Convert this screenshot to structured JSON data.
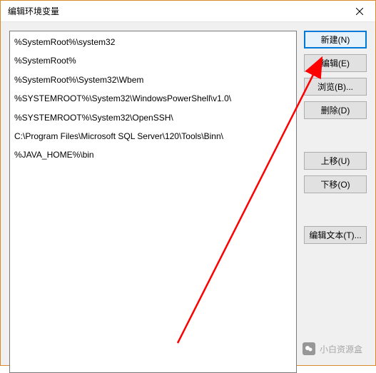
{
  "window": {
    "title": "编辑环境变量"
  },
  "list": {
    "items": [
      "%SystemRoot%\\system32",
      "%SystemRoot%",
      "%SystemRoot%\\System32\\Wbem",
      "%SYSTEMROOT%\\System32\\WindowsPowerShell\\v1.0\\",
      "%SYSTEMROOT%\\System32\\OpenSSH\\",
      "C:\\Program Files\\Microsoft SQL Server\\120\\Tools\\Binn\\",
      "%JAVA_HOME%\\bin"
    ]
  },
  "buttons": {
    "new": "新建(N)",
    "edit": "编辑(E)",
    "browse": "浏览(B)...",
    "delete": "删除(D)",
    "moveUp": "上移(U)",
    "moveDown": "下移(O)",
    "editText": "编辑文本(T)..."
  },
  "watermark": {
    "text": "小白资源盒"
  }
}
